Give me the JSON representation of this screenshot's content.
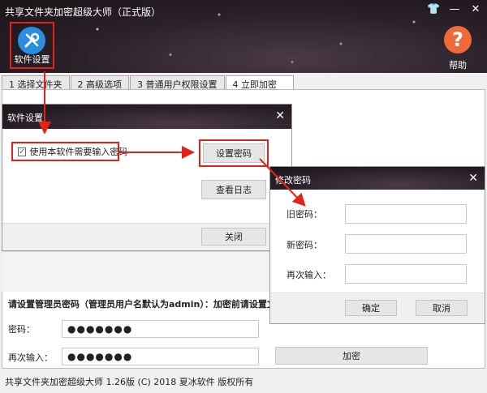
{
  "app": {
    "title": "共享文件夹加密超级大师（正式版）",
    "accent_color": "#2b8de0",
    "help_color": "#f0693b",
    "highlight_color": "#e0241a"
  },
  "window_controls": [
    {
      "name": "skin-icon",
      "glyph": "👕"
    },
    {
      "name": "minimize-icon",
      "glyph": "—"
    },
    {
      "name": "close-icon",
      "glyph": "✕"
    }
  ],
  "toolbar": {
    "settings_label": "软件设置",
    "settings_icon": "tools-icon",
    "help_label": "帮助",
    "help_icon": "question-icon",
    "help_glyph": "?"
  },
  "tabs": [
    {
      "label": "1 选择文件夹",
      "active": false
    },
    {
      "label": "2 高级选项",
      "active": false
    },
    {
      "label": "3 普通用户权限设置",
      "active": false
    },
    {
      "label": "4 立即加密",
      "active": true
    }
  ],
  "settings_dialog": {
    "title": "软件设置",
    "close_glyph": "✕",
    "checkbox_label": "使用本软件需要输入密码",
    "checkbox_checked": true,
    "checkmark": "✓",
    "set_password_button": "设置密码",
    "view_log_button": "查看日志",
    "close_button": "关闭"
  },
  "password_dialog": {
    "title": "修改密码",
    "close_glyph": "✕",
    "old_label": "旧密码：",
    "new_label": "新密码：",
    "repeat_label": "再次输入：",
    "old_value": "",
    "new_value": "",
    "repeat_value": "",
    "ok_button": "确定",
    "cancel_button": "取消"
  },
  "main": {
    "admin_note": "请设置管理员密码（管理员用户名默认为admin）：加密前请设置文件夹为共",
    "password_label": "密码：",
    "password_value": "●●●●●●●",
    "repeat_label": "再次输入：",
    "repeat_value": "●●●●●●●",
    "encrypt_button": "加密"
  },
  "status_bar": {
    "text": "共享文件夹加密超级大师 1.26版 (C) 2018 夏冰软件 版权所有"
  }
}
